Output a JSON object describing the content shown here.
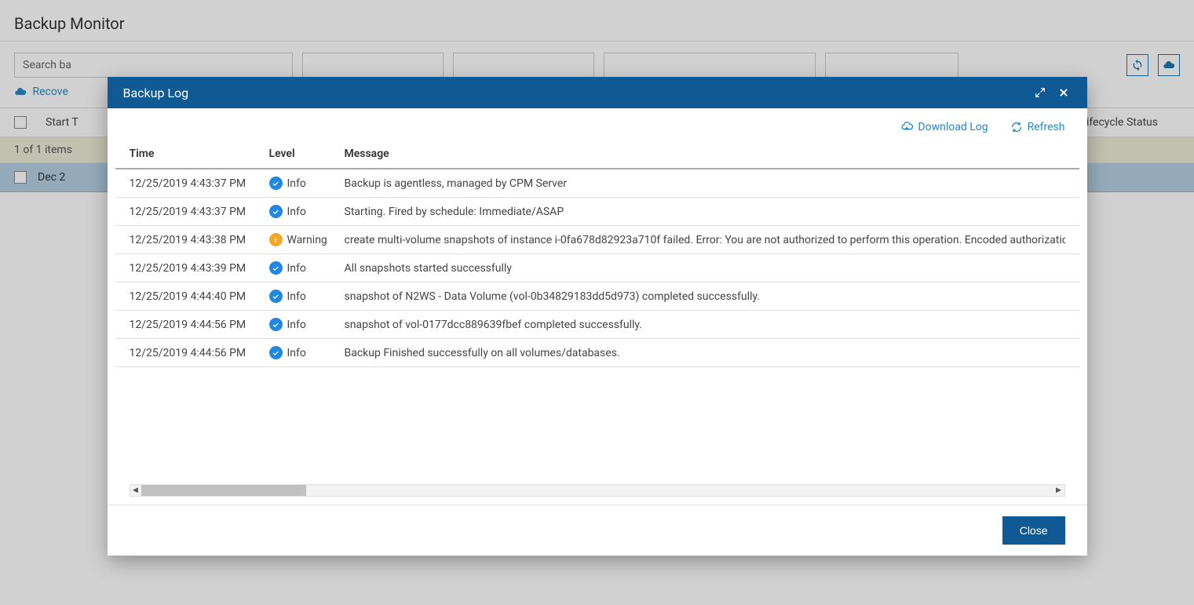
{
  "page": {
    "title": "Backup Monitor",
    "search_placeholder": "Search ba",
    "recover_label": "Recove",
    "table_headers": {
      "start_time": "Start T",
      "lifecycle_status": "Lifecycle Status"
    },
    "status_text": "1 of 1 items",
    "row_date": "Dec 2"
  },
  "modal": {
    "title": "Backup Log",
    "download_label": "Download Log",
    "refresh_label": "Refresh",
    "close_label": "Close",
    "columns": {
      "time": "Time",
      "level": "Level",
      "message": "Message"
    },
    "rows": [
      {
        "time": "12/25/2019 4:43:37 PM",
        "level": "Info",
        "level_type": "info",
        "message": "Backup is agentless, managed by CPM Server"
      },
      {
        "time": "12/25/2019 4:43:37 PM",
        "level": "Info",
        "level_type": "info",
        "message": "Starting. Fired by schedule: Immediate/ASAP"
      },
      {
        "time": "12/25/2019 4:43:38 PM",
        "level": "Warning",
        "level_type": "warning",
        "message": "create multi-volume snapshots of instance i-0fa678d82923a710f failed. Error: You are not authorized to perform this operation. Encoded authorization f"
      },
      {
        "time": "12/25/2019 4:43:39 PM",
        "level": "Info",
        "level_type": "info",
        "message": "All snapshots started successfully"
      },
      {
        "time": "12/25/2019 4:44:40 PM",
        "level": "Info",
        "level_type": "info",
        "message": "snapshot of N2WS - Data Volume (vol-0b34829183dd5d973) completed successfully."
      },
      {
        "time": "12/25/2019 4:44:56 PM",
        "level": "Info",
        "level_type": "info",
        "message": "snapshot of vol-0177dcc889639fbef completed successfully."
      },
      {
        "time": "12/25/2019 4:44:56 PM",
        "level": "Info",
        "level_type": "info",
        "message": "Backup Finished successfully on all volumes/databases."
      }
    ]
  }
}
